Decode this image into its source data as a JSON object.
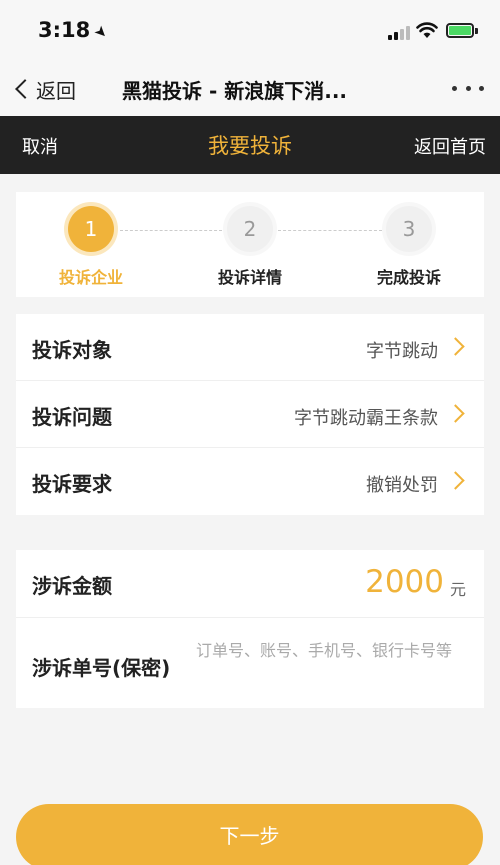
{
  "status_bar": {
    "time": "3:18"
  },
  "nav": {
    "back_label": "返回",
    "title": "黑猫投诉 - 新浪旗下消..."
  },
  "header": {
    "cancel": "取消",
    "title": "我要投诉",
    "home": "返回首页"
  },
  "steps": [
    {
      "number": "1",
      "label": "投诉企业",
      "active": true
    },
    {
      "number": "2",
      "label": "投诉详情",
      "active": false
    },
    {
      "number": "3",
      "label": "完成投诉",
      "active": false
    }
  ],
  "complaint": {
    "target": {
      "label": "投诉对象",
      "value": "字节跳动"
    },
    "issue": {
      "label": "投诉问题",
      "value": "字节跳动霸王条款"
    },
    "request": {
      "label": "投诉要求",
      "value": "撤销处罚"
    }
  },
  "details": {
    "amount": {
      "label": "涉诉金额",
      "value": "2000",
      "unit": "元"
    },
    "order": {
      "label": "涉诉单号(保密)",
      "placeholder": "订单号、账号、手机号、银行卡号等"
    }
  },
  "next_button": "下一步",
  "colors": {
    "accent": "#f0b33a",
    "header_bg": "#222222",
    "battery": "#4cd964"
  }
}
